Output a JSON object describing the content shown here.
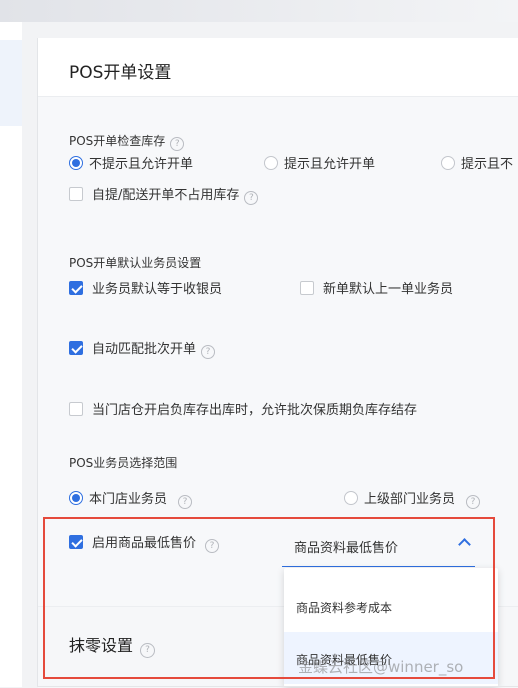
{
  "card": {
    "title": "POS开单设置"
  },
  "stock_check": {
    "label": "POS开单检查库存",
    "options": [
      "不提示且允许开单",
      "提示且允许开单",
      "提示且不"
    ],
    "selected": 0,
    "self_pickup": {
      "label": "自提/配送开单不占用库存",
      "checked": false
    }
  },
  "salesperson_default": {
    "label": "POS开单默认业务员设置",
    "opt1": {
      "label": "业务员默认等于收银员",
      "checked": true
    },
    "opt2": {
      "label": "新单默认上一单业务员",
      "checked": false
    }
  },
  "auto_batch": {
    "label": "自动匹配批次开单",
    "checked": true
  },
  "negative_stock": {
    "label": "当门店仓开启负库存出库时，允许批次保质期负库存结存",
    "checked": false
  },
  "salesperson_scope": {
    "label": "POS业务员选择范围",
    "options": [
      "本门店业务员",
      "上级部门业务员"
    ],
    "selected": 0
  },
  "min_price": {
    "label": "启用商品最低售价",
    "checked": true,
    "select_value": "商品资料最低售价",
    "dropdown_options": [
      "商品资料参考成本",
      "商品资料最低售价"
    ],
    "dropdown_selected": 1
  },
  "rounding": {
    "title": "抹零设置"
  },
  "help_icon_glyph": "?",
  "watermark": "金蝶云社区@winner_so",
  "colors": {
    "accent": "#2f6fe0",
    "highlight": "#e54a3c"
  }
}
